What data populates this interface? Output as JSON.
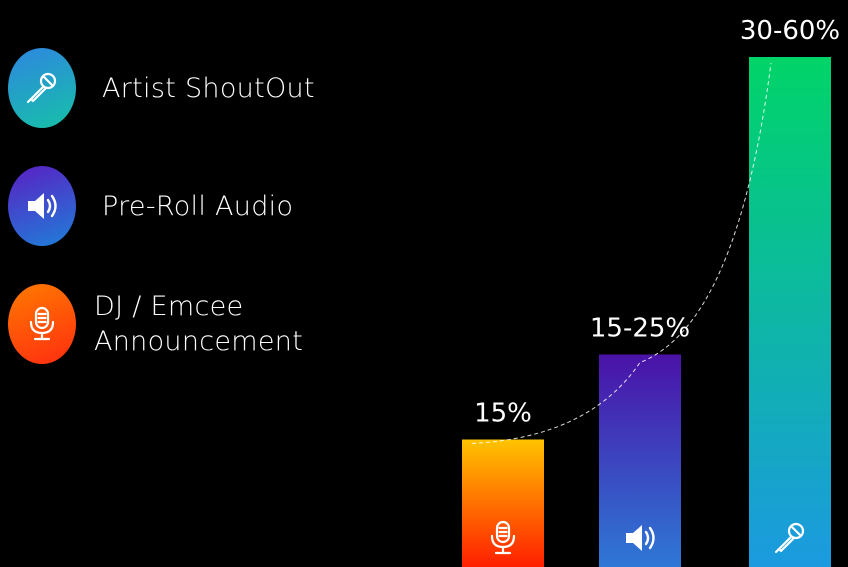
{
  "legend": [
    {
      "label": "Artist ShoutOut",
      "icon": "microphone-icon",
      "gradient": [
        "#2e86e0",
        "#16c1a8"
      ]
    },
    {
      "label": "Pre-Roll Audio",
      "icon": "speaker-icon",
      "gradient": [
        "#5a1fc4",
        "#1f7fd8"
      ]
    },
    {
      "label_lines": [
        "DJ / Emcee",
        "Announcement"
      ],
      "icon": "podcast-microphone-icon",
      "gradient": [
        "#ff7a00",
        "#ff2d10"
      ]
    }
  ],
  "chart_data": {
    "type": "bar",
    "categories": [
      "DJ / Emcee Announcement",
      "Pre-Roll Audio",
      "Artist ShoutOut"
    ],
    "values": [
      15,
      25,
      60
    ],
    "value_labels": [
      "15%",
      "15-25%",
      "30-60%"
    ],
    "ylim": [
      0,
      60
    ],
    "grid": false,
    "trend_line": "dashed-white",
    "bar_icons": [
      "podcast-microphone-icon",
      "speaker-icon",
      "microphone-icon"
    ],
    "colors": {
      "dj": [
        "#ffc400",
        "#ff1e00"
      ],
      "preroll": [
        "#4a12a8",
        "#2e78d6"
      ],
      "artist": [
        "#00d468",
        "#1b9ae0"
      ]
    }
  }
}
